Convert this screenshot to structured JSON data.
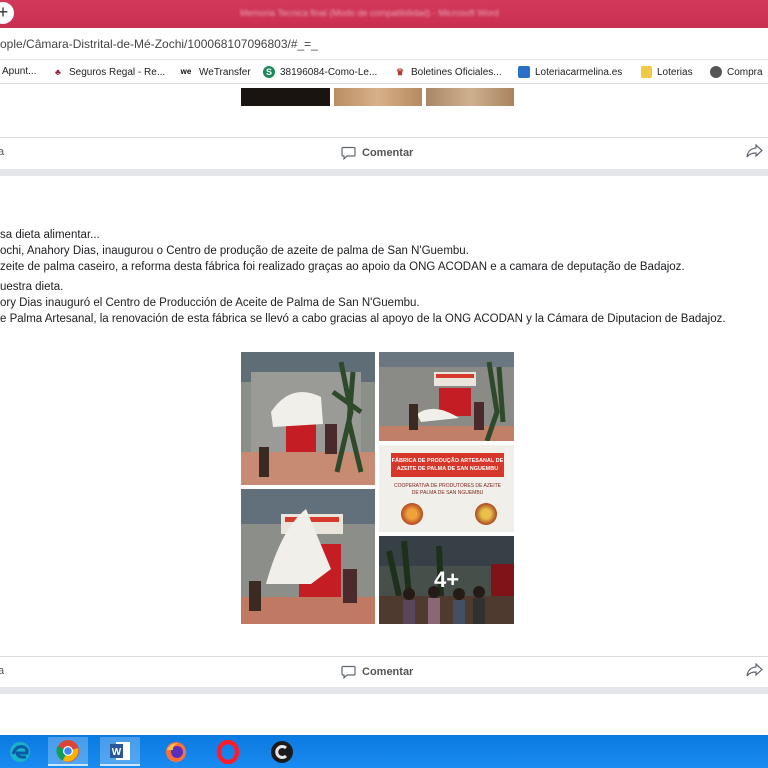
{
  "browser": {
    "window_title": "Memoria Tecnica final (Modo de compatibilidad) - Microsoft Word",
    "new_tab_glyph": "+",
    "url": "ople/Câmara-Distrital-de-Mé-Zochi/100068107096803/#_=_",
    "bookmarks": [
      {
        "label": "Apunt...",
        "icon": "bookmark-icon",
        "color": "#888"
      },
      {
        "label": "Seguros Regal - Re...",
        "icon": "regal-icon",
        "color": "#9b1d3a"
      },
      {
        "label": "WeTransfer",
        "icon": "wetransfer-icon",
        "color": "#111"
      },
      {
        "label": "38196084-Como-Le...",
        "icon": "globe-icon",
        "color": "#1a8a5a"
      },
      {
        "label": "Boletines Oficiales...",
        "icon": "boletines-icon",
        "color": "#b43a2a"
      },
      {
        "label": "Loteriacarmelina.es",
        "icon": "loteria-icon",
        "color": "#2a6fc9"
      },
      {
        "label": "Loterias",
        "icon": "folder-icon",
        "color": "#f2c744"
      },
      {
        "label": "Compra",
        "icon": "globe-icon",
        "color": "#555"
      }
    ]
  },
  "post1": {
    "like_label": "a",
    "comment_label": "Comentar"
  },
  "post2": {
    "text_lines": [
      "sa dieta alimentar...",
      "ochi, Anahory Dias, inaugurou o Centro de produção de azeite de palma de San N'Guembu.",
      "zeite de palma caseiro, a reforma desta fábrica foi realizado graças ao apoio da ONG ACODAN e a camara de deputação de Badajoz.",
      "uestra dieta.",
      "ory Dias inauguró el Centro de Producción de Aceite de Palma de San N'Guembu.",
      "e Palma Artesanal, la renovación de esta fábrica se llevó a cabo gracias al apoyo de la ONG ACODAN y la Cámara de Diputacion de Badajoz."
    ],
    "sign_title": "FÁBRICA DE PRODUÇÃO ARTESANAL DE AZEITE DE PALMA DE SAN NGUEMBU",
    "sign_subtitle": "COOPERATIVA DE PRODUTORES DE AZEITE DE PALMA DE SAN NGUEMBU",
    "more_photos": "4+",
    "like_label": "a",
    "comment_label": "Comentar"
  },
  "taskbar": {
    "apps": [
      "edge-icon",
      "chrome-icon",
      "word-icon",
      "firefox-icon",
      "opera-icon",
      "ccleaner-icon"
    ],
    "word_letter": "W"
  }
}
